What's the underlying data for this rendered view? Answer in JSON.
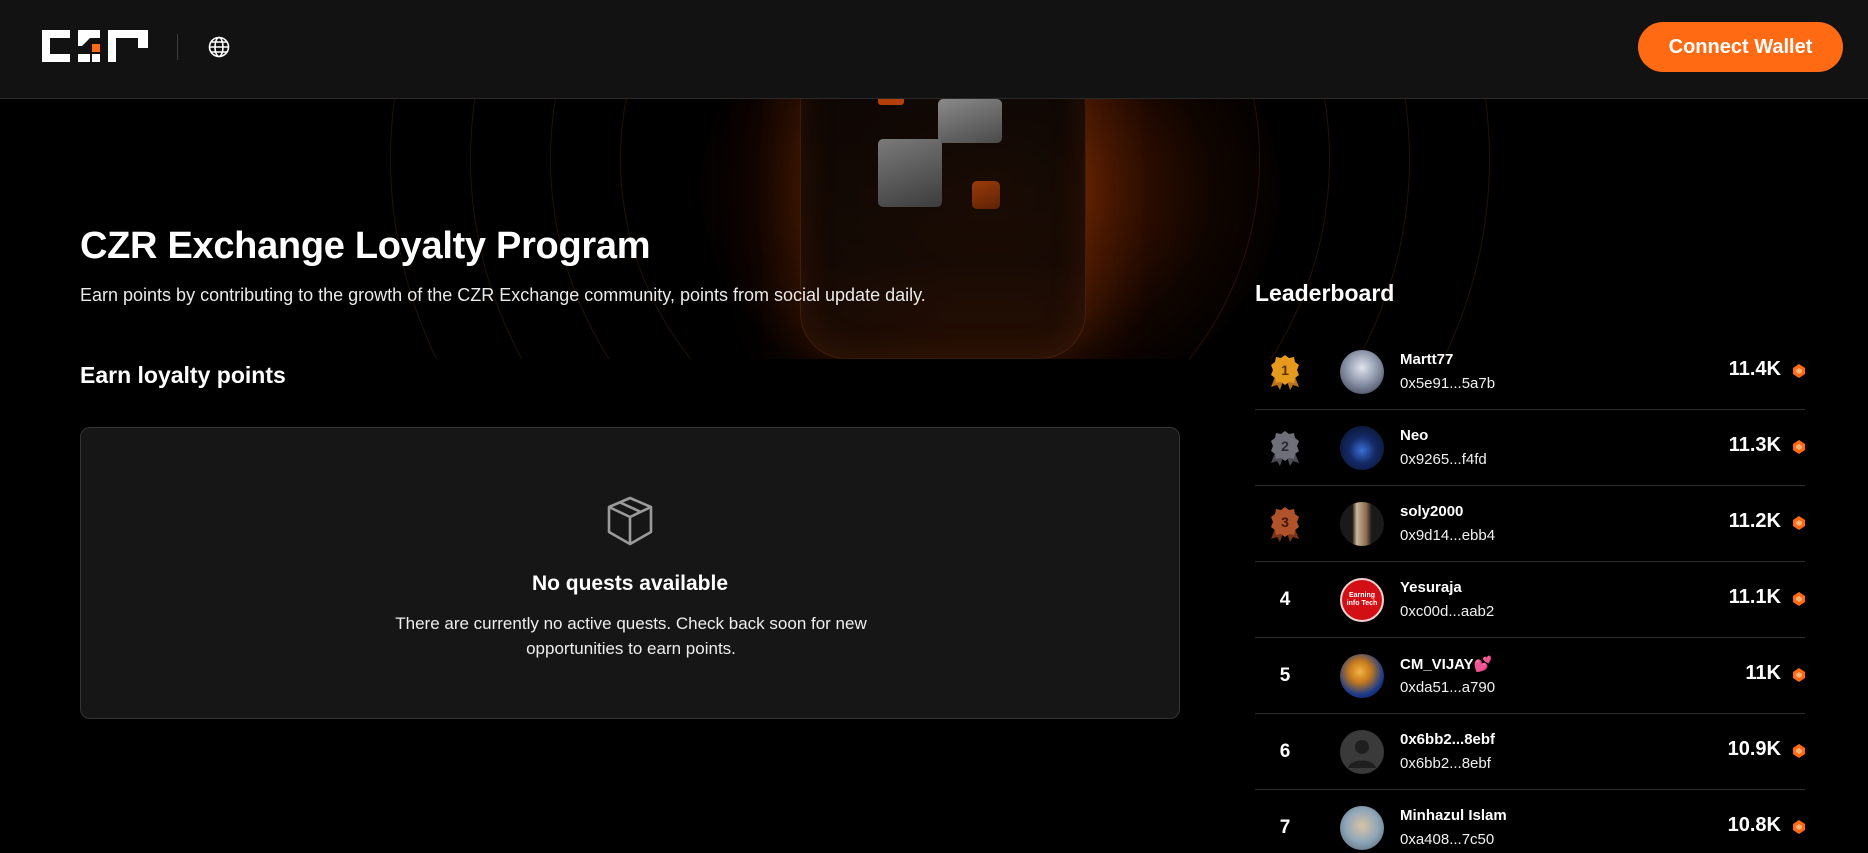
{
  "header": {
    "logo_text": "CZR",
    "connect_label": "Connect Wallet"
  },
  "hero": {
    "title": "CZR Exchange Loyalty Program",
    "subtitle": "Earn points by contributing to the growth of the CZR Exchange community, points from social update daily."
  },
  "quests": {
    "section_title": "Earn loyalty points",
    "empty_title": "No quests available",
    "empty_text": "There are currently no active quests. Check back soon for new opportunities to earn points."
  },
  "leaderboard": {
    "title": "Leaderboard",
    "rows": [
      {
        "rank": "1",
        "name": "Martt77",
        "address": "0x5e91...5a7b",
        "points": "11.4K"
      },
      {
        "rank": "2",
        "name": "Neo",
        "address": "0x9265...f4fd",
        "points": "11.3K"
      },
      {
        "rank": "3",
        "name": "soly2000",
        "address": "0x9d14...ebb4",
        "points": "11.2K"
      },
      {
        "rank": "4",
        "name": "Yesuraja",
        "address": "0xc00d...aab2",
        "points": "11.1K",
        "avatar_text": "Earning info Tech"
      },
      {
        "rank": "5",
        "name": "CM_VIJAY",
        "name_suffix": "💕",
        "address": "0xda51...a790",
        "points": "11K"
      },
      {
        "rank": "6",
        "name": "0x6bb2...8ebf",
        "address": "0x6bb2...8ebf",
        "points": "10.9K"
      },
      {
        "rank": "7",
        "name": "Minhazul Islam",
        "address": "0xa408...7c50",
        "points": "10.8K"
      }
    ]
  },
  "colors": {
    "accent": "#ff6a13",
    "gold": "#e59a1e",
    "silver": "#6f6f7a",
    "bronze": "#b0522a"
  },
  "icons": [
    "globe-icon",
    "box-icon",
    "medal-icon",
    "coin-icon",
    "user-placeholder-icon"
  ]
}
